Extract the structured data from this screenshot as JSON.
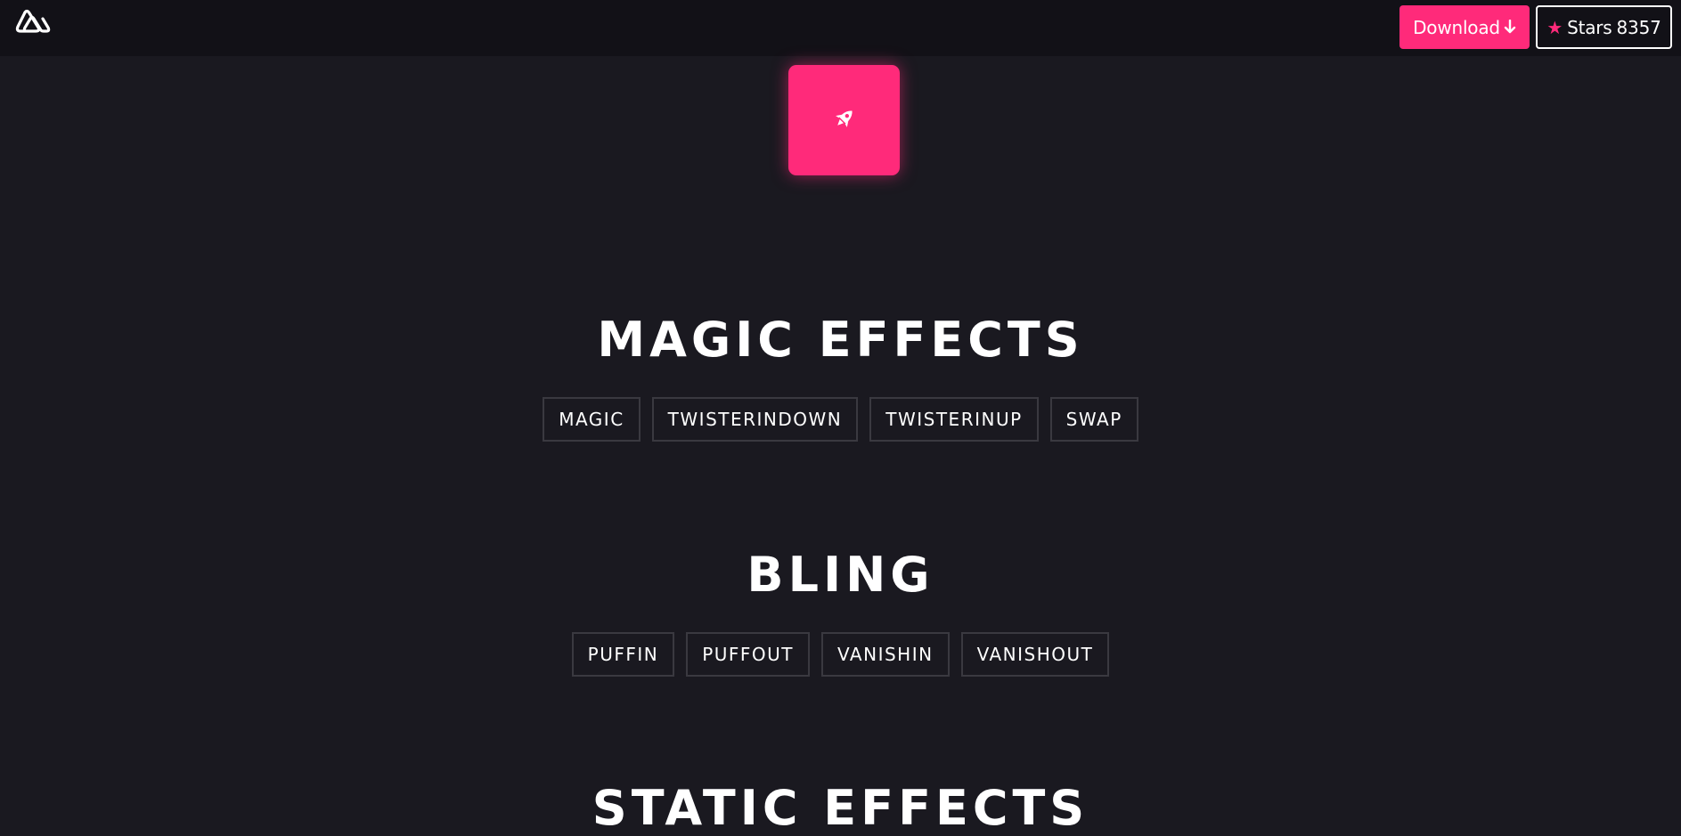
{
  "header": {
    "logo_icon": "nuxt-triangle-logo-icon",
    "download_label": "Download",
    "download_icon": "arrow-down-icon",
    "stars_icon": "star-icon",
    "stars_label": "Stars",
    "stars_count": "8357"
  },
  "hero": {
    "icon": "rocket-icon"
  },
  "sections": [
    {
      "title": "MAGIC EFFECTS",
      "effects": [
        "MAGIC",
        "TWISTERINDOWN",
        "TWISTERINUP",
        "SWAP"
      ]
    },
    {
      "title": "BLING",
      "effects": [
        "PUFFIN",
        "PUFFOUT",
        "VANISHIN",
        "VANISHOUT"
      ]
    },
    {
      "title": "STATIC EFFECTS"
    }
  ],
  "colors": {
    "accent": "#ff2a7a",
    "background": "#1a1920",
    "header_background": "#121117",
    "chip_border": "#3a3940"
  }
}
